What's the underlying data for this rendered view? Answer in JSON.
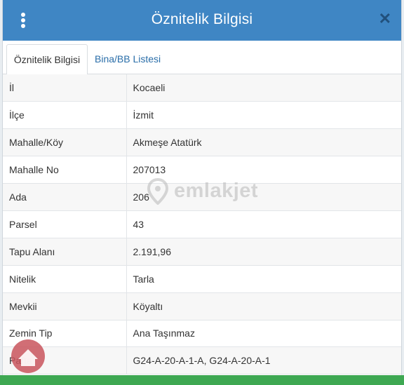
{
  "dialog": {
    "title": "Öznitelik Bilgisi",
    "menu_icon": "vertical-dots-icon",
    "close_icon": "close-icon",
    "close_glyph": "✕"
  },
  "tabs": [
    {
      "label": "Öznitelik Bilgisi",
      "active": true
    },
    {
      "label": "Bina/BB Listesi",
      "active": false
    }
  ],
  "attributes": [
    {
      "key": "İl",
      "value": "Kocaeli"
    },
    {
      "key": "İlçe",
      "value": "İzmit"
    },
    {
      "key": "Mahalle/Köy",
      "value": "Akmeşe Atatürk"
    },
    {
      "key": "Mahalle No",
      "value": "207013"
    },
    {
      "key": "Ada",
      "value": "206"
    },
    {
      "key": "Parsel",
      "value": "43"
    },
    {
      "key": "Tapu Alanı",
      "value": "2.191,96"
    },
    {
      "key": "Nitelik",
      "value": "Tarla"
    },
    {
      "key": "Mevkii",
      "value": "Köyaltı"
    },
    {
      "key": "Zemin Tip",
      "value": "Ana Taşınmaz"
    },
    {
      "key": "Pafta",
      "value": "G24-A-20-A-1-A, G24-A-20-A-1"
    }
  ],
  "watermark": {
    "text": "emlakjet"
  },
  "colors": {
    "header": "#3f86c4",
    "tab_link": "#2a6ea9",
    "close_icon": "#21507c",
    "bottom_bar": "#3ea852"
  }
}
